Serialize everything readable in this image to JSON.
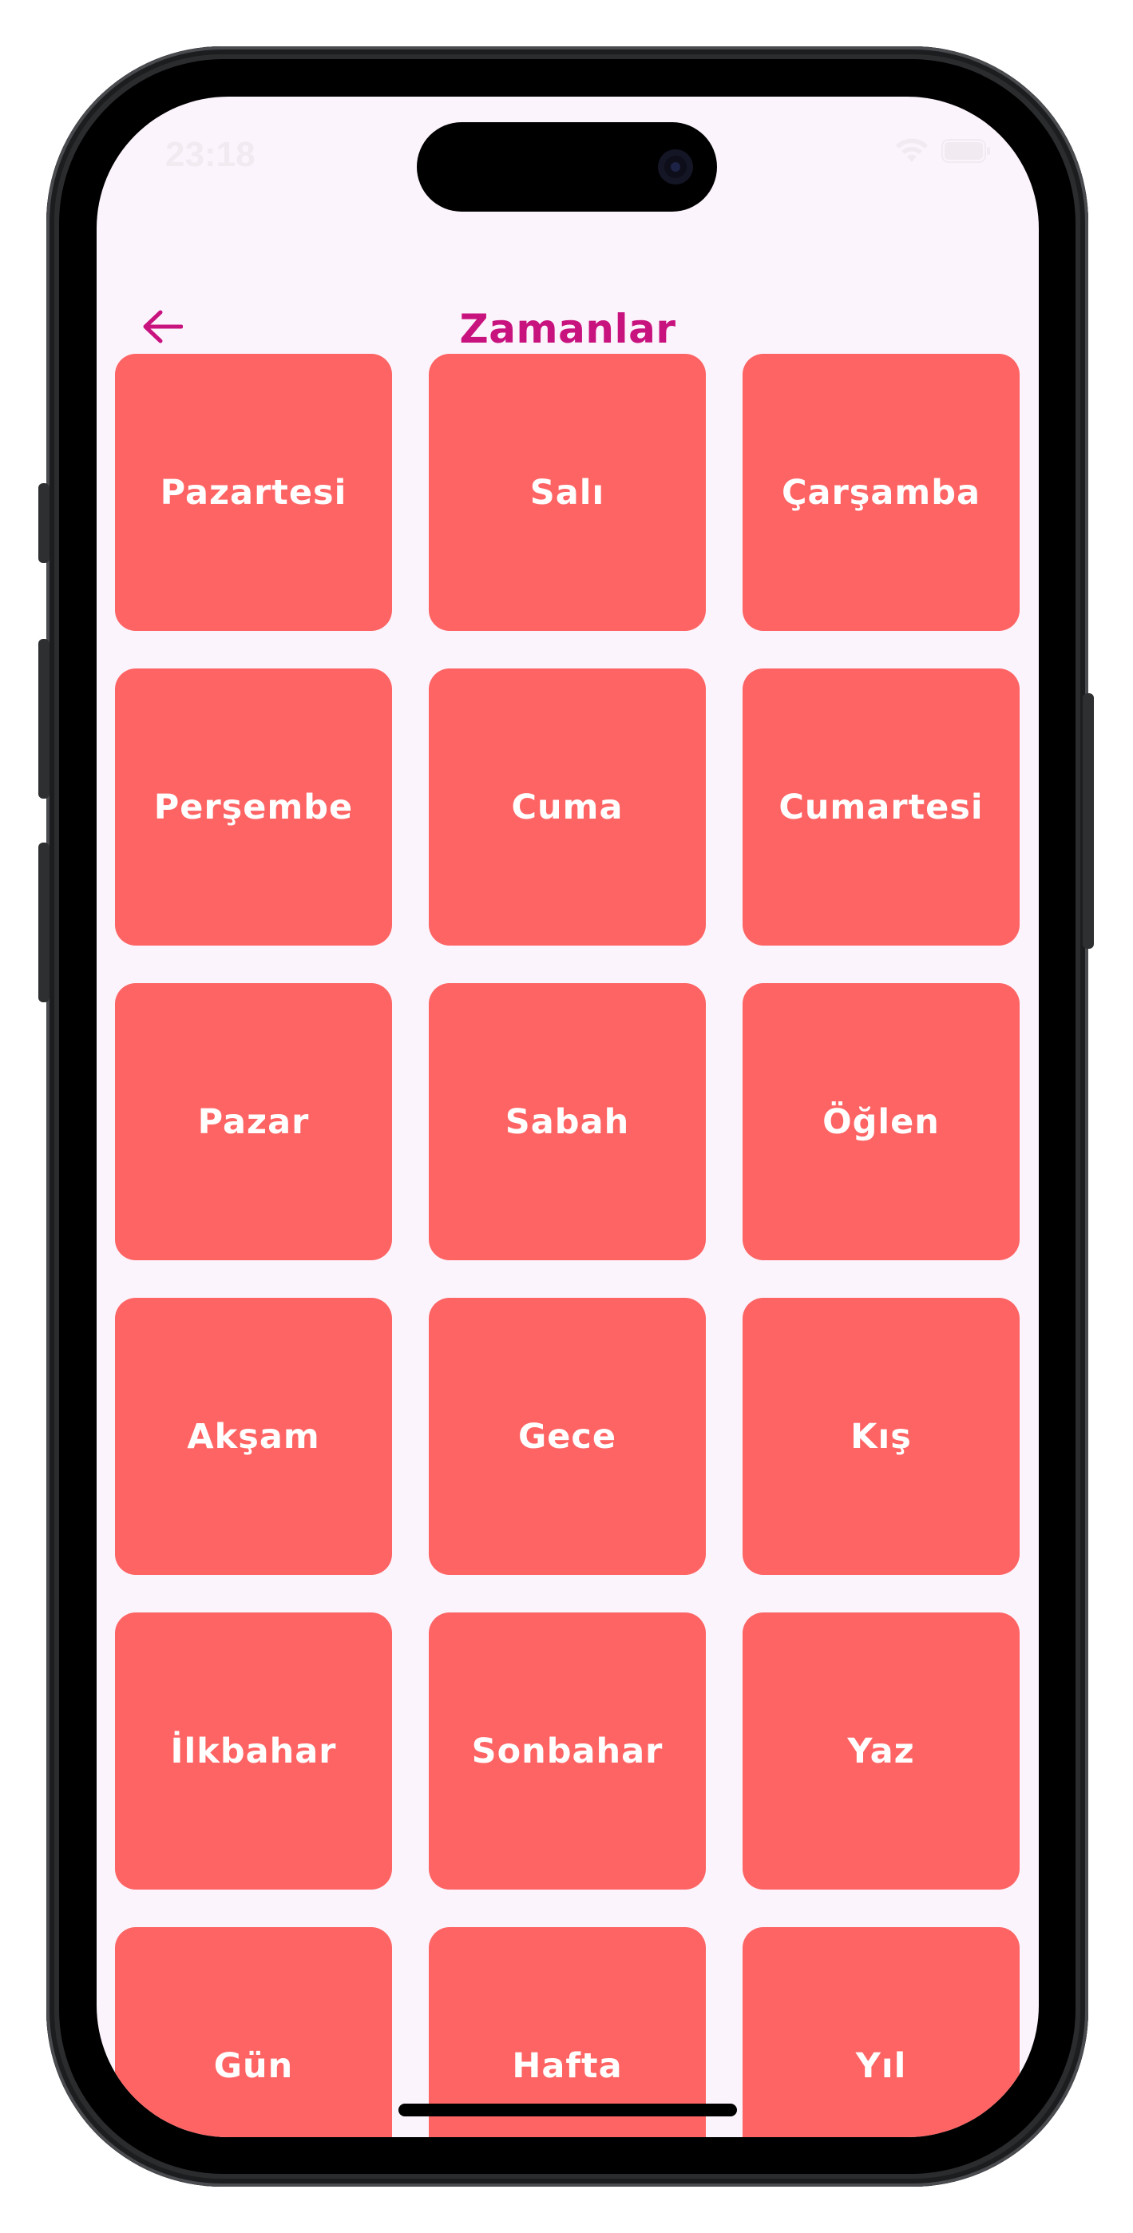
{
  "status_bar": {
    "time": "23:18",
    "icons": [
      "wifi-icon",
      "battery-icon"
    ]
  },
  "app_bar": {
    "back_icon": "arrow-left-icon",
    "title": "Zamanlar"
  },
  "colors": {
    "background": "#fcf4fc",
    "title": "#c8137f",
    "tile": "#fe6464",
    "tile_text": "#ffffff"
  },
  "tiles": [
    {
      "label": "Pazartesi"
    },
    {
      "label": "Salı"
    },
    {
      "label": "Çarşamba"
    },
    {
      "label": "Perşembe"
    },
    {
      "label": "Cuma"
    },
    {
      "label": "Cumartesi"
    },
    {
      "label": "Pazar"
    },
    {
      "label": "Sabah"
    },
    {
      "label": "Öğlen"
    },
    {
      "label": "Akşam"
    },
    {
      "label": "Gece"
    },
    {
      "label": "Kış"
    },
    {
      "label": "İlkbahar"
    },
    {
      "label": "Sonbahar"
    },
    {
      "label": "Yaz"
    },
    {
      "label": "Gün"
    },
    {
      "label": "Hafta"
    },
    {
      "label": "Yıl"
    }
  ]
}
